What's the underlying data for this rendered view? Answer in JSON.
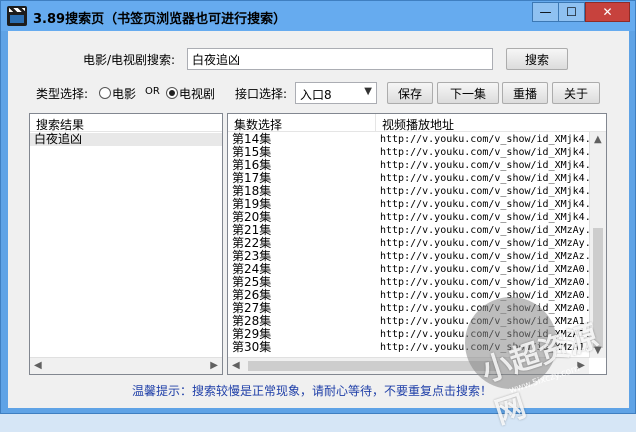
{
  "window": {
    "title": "3.89搜索页（书签页浏览器也可进行搜索）",
    "minimize_glyph": "—",
    "maximize_glyph": "☐",
    "close_glyph": "✕"
  },
  "search": {
    "label": "电影/电视剧搜索:",
    "value": "白夜追凶",
    "button_label": "搜索"
  },
  "options": {
    "type_label": "类型选择:",
    "movie_label": "电影",
    "or_label": "OR",
    "tv_label": "电视剧",
    "selected_type": "tv",
    "interface_label": "接口选择:",
    "interface_value": "入口8"
  },
  "toolbar": {
    "save_label": "保存",
    "next_label": "下一集",
    "replay_label": "重播",
    "about_label": "关于"
  },
  "results": {
    "header": "搜索结果",
    "items": [
      "白夜追凶"
    ]
  },
  "episodes": {
    "col_episode": "集数选择",
    "col_url": "视频播放地址",
    "rows": [
      {
        "ep": "第14集",
        "url": "http://v.youku.com/v_show/id_XMjk4.."
      },
      {
        "ep": "第15集",
        "url": "http://v.youku.com/v_show/id_XMjk4.."
      },
      {
        "ep": "第16集",
        "url": "http://v.youku.com/v_show/id_XMjk4.."
      },
      {
        "ep": "第17集",
        "url": "http://v.youku.com/v_show/id_XMjk4.."
      },
      {
        "ep": "第18集",
        "url": "http://v.youku.com/v_show/id_XMjk4.."
      },
      {
        "ep": "第19集",
        "url": "http://v.youku.com/v_show/id_XMjk4.."
      },
      {
        "ep": "第20集",
        "url": "http://v.youku.com/v_show/id_XMjk4.."
      },
      {
        "ep": "第21集",
        "url": "http://v.youku.com/v_show/id_XMzAy.."
      },
      {
        "ep": "第22集",
        "url": "http://v.youku.com/v_show/id_XMzAy.."
      },
      {
        "ep": "第23集",
        "url": "http://v.youku.com/v_show/id_XMzAz.."
      },
      {
        "ep": "第24集",
        "url": "http://v.youku.com/v_show/id_XMzA0.."
      },
      {
        "ep": "第25集",
        "url": "http://v.youku.com/v_show/id_XMzA0.."
      },
      {
        "ep": "第26集",
        "url": "http://v.youku.com/v_show/id_XMzA0.."
      },
      {
        "ep": "第27集",
        "url": "http://v.youku.com/v_show/id_XMzA0.."
      },
      {
        "ep": "第28集",
        "url": "http://v.youku.com/v_show/id_XMzA1.."
      },
      {
        "ep": "第29集",
        "url": "http://v.youku.com/v_show/id_XMzA1.."
      },
      {
        "ep": "第30集",
        "url": "http://v.youku.com/v_show/id_XMzA1.."
      }
    ]
  },
  "hint": "温馨提示：搜索较慢是正常现象，请耐心等待，不要重复点击搜索！",
  "watermark": {
    "text": "小超资源网",
    "site": "www.5ixczy.com"
  }
}
